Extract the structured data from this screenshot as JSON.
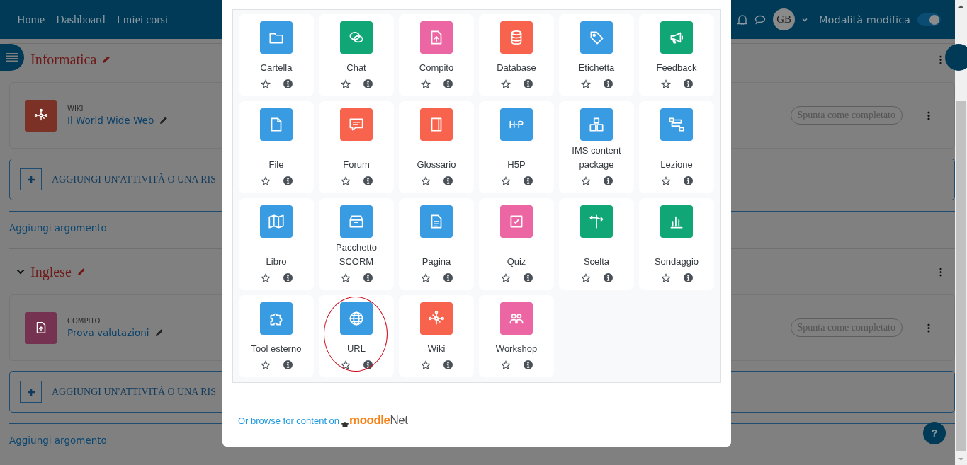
{
  "navbar": {
    "links": [
      "Home",
      "Dashboard",
      "I miei corsi"
    ],
    "avatar": "GB",
    "edit_mode": {
      "label": "Modalità modifica",
      "on": true
    }
  },
  "sections": [
    {
      "title": "Informatica",
      "activity": {
        "type": "WIKI",
        "name": "Il World Wide Web",
        "color": "#7b3126",
        "completion": "Spunta come completato"
      },
      "add_button": "AGGIUNGI UN'ATTIVITÀ O UNA RIS",
      "add_topic": "Aggiungi argomento"
    },
    {
      "title": "Inglese",
      "activity": {
        "type": "COMPITO",
        "name": "Prova valutazioni",
        "color": "#753351",
        "completion": "Spunta come completato"
      },
      "add_button": "AGGIUNGI UN'ATTIVITÀ O UNA RIS",
      "add_topic": "Aggiungi argomento"
    }
  ],
  "chooser": {
    "items": [
      {
        "label": "Cartella",
        "color": "#399be2",
        "circled": false
      },
      {
        "label": "Chat",
        "color": "#11a676",
        "circled": false
      },
      {
        "label": "Compito",
        "color": "#eb66a2",
        "circled": false
      },
      {
        "label": "Database",
        "color": "#f7634d",
        "circled": false
      },
      {
        "label": "Etichetta",
        "color": "#399be2",
        "circled": false
      },
      {
        "label": "Feedback",
        "color": "#11a676",
        "circled": false
      },
      {
        "label": "File",
        "color": "#399be2",
        "circled": false
      },
      {
        "label": "Forum",
        "color": "#f7634d",
        "circled": false
      },
      {
        "label": "Glossario",
        "color": "#f7634d",
        "circled": false
      },
      {
        "label": "H5P",
        "color": "#399be2",
        "circled": false
      },
      {
        "label": "IMS content package",
        "color": "#399be2",
        "circled": false
      },
      {
        "label": "Lezione",
        "color": "#399be2",
        "circled": false
      },
      {
        "label": "Libro",
        "color": "#399be2",
        "circled": false
      },
      {
        "label": "Pacchetto SCORM",
        "color": "#399be2",
        "circled": false
      },
      {
        "label": "Pagina",
        "color": "#399be2",
        "circled": false
      },
      {
        "label": "Quiz",
        "color": "#eb66a2",
        "circled": false
      },
      {
        "label": "Scelta",
        "color": "#11a676",
        "circled": false
      },
      {
        "label": "Sondaggio",
        "color": "#11a676",
        "circled": false
      },
      {
        "label": "Tool esterno",
        "color": "#399be2",
        "circled": false
      },
      {
        "label": "URL",
        "color": "#399be2",
        "circled": true
      },
      {
        "label": "Wiki",
        "color": "#f7634d",
        "circled": false
      },
      {
        "label": "Workshop",
        "color": "#eb66a2",
        "circled": false
      }
    ],
    "footer": {
      "text": "Or browse for content on",
      "brand_first": "moodle",
      "brand_second": "Net"
    }
  },
  "help_button": "?"
}
